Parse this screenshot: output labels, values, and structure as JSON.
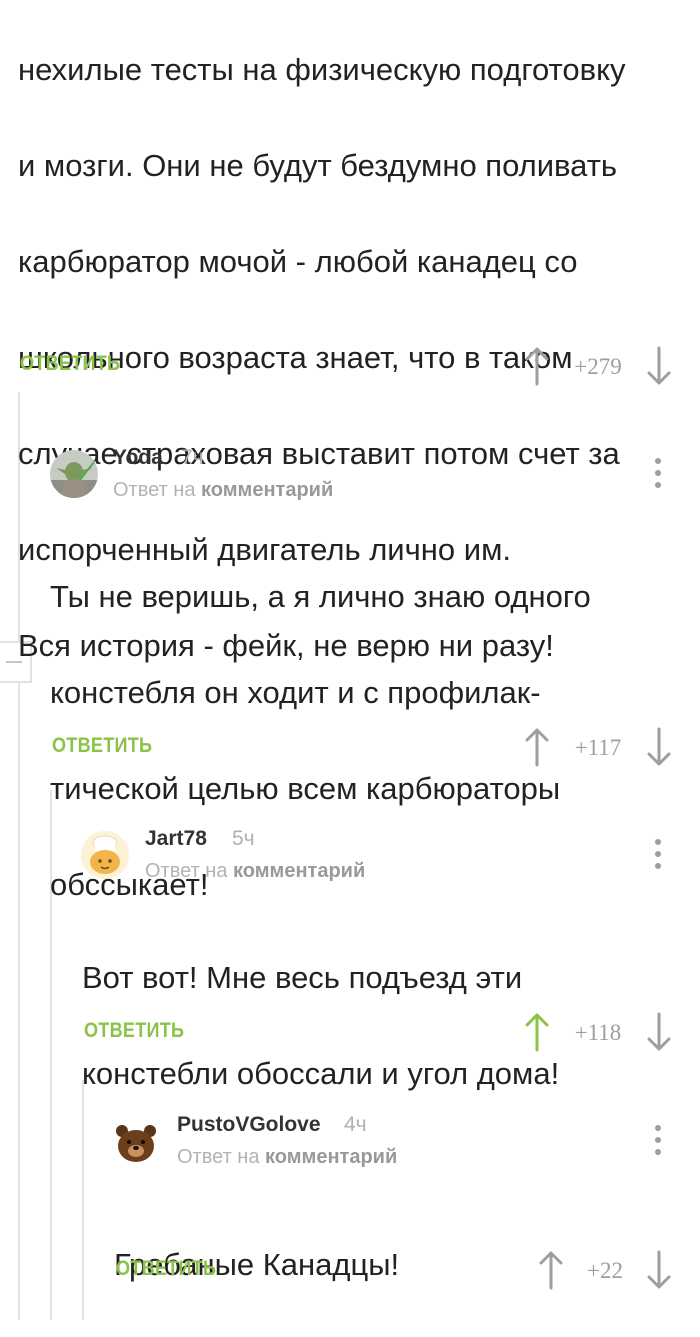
{
  "top_comment": {
    "text_lines": [
      "нехилые тесты на физическую подготовку",
      "и мозги. Они не будут бездумно  поливать",
      "карбюратор мочой - любой канадец со",
      "школьного возраста знает, что в таком",
      "случае страховая выставит потом счет за",
      "испорченный двигатель лично им.",
      "Вся история - фейк, не верю ни разу!"
    ],
    "reply_label": "ОТВЕТИТЬ",
    "score": "+279"
  },
  "comments": [
    {
      "author": "Yoda",
      "time": "7ч",
      "reply_prefix": "Ответ на",
      "reply_target": "комментарий",
      "text_lines": [
        "Ты не веришь, а я лично знаю одного",
        "констебля он ходит и с профилак-",
        "тической целью всем карбюраторы",
        "обссыкает!"
      ],
      "reply_label": "ОТВЕТИТЬ",
      "score": "+117"
    },
    {
      "author": "Jart78",
      "time": "5ч",
      "reply_prefix": "Ответ на",
      "reply_target": "комментарий",
      "text_lines": [
        "Вот вот! Мне весь подъезд эти",
        "констебли обоссали и угол дома!"
      ],
      "reply_label": "ОТВЕТИТЬ",
      "score": "+118"
    },
    {
      "author": "PustoVGolove",
      "time": "4ч",
      "reply_prefix": "Ответ на",
      "reply_target": "комментарий",
      "text_lines": [
        "Гребаные Канадцы!"
      ],
      "reply_label": "ОТВЕТИТЬ",
      "score": "+22"
    }
  ],
  "colors": {
    "accent_green": "#8bc34a",
    "muted": "#9e9e9e",
    "thread_line": "#e2e2e2"
  }
}
